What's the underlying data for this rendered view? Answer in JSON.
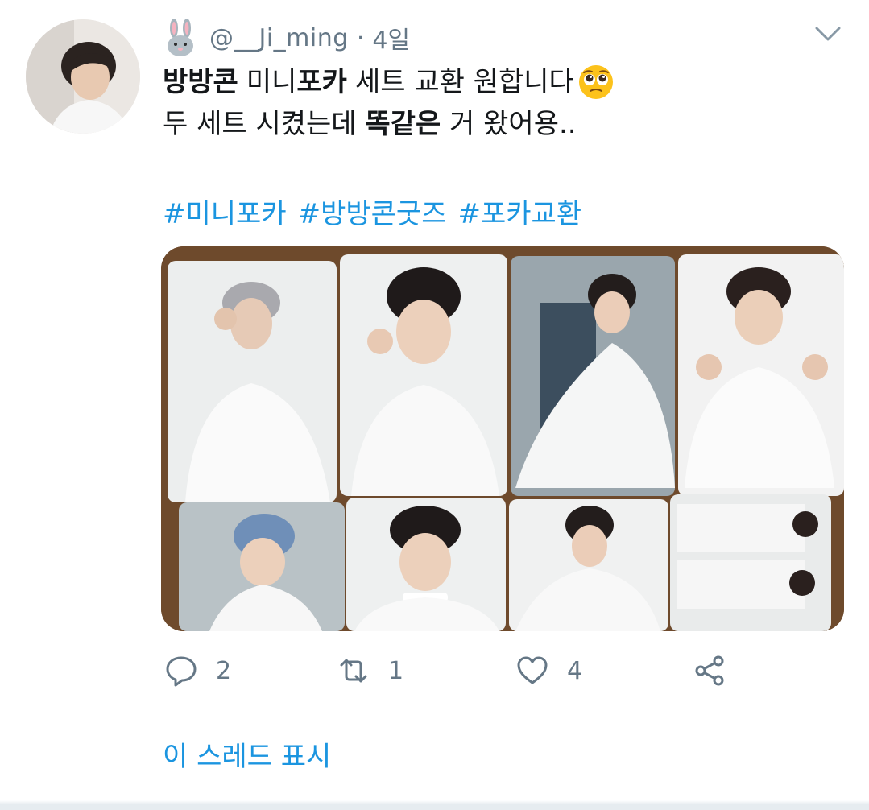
{
  "author": {
    "handle": "@__Ji_ming",
    "separator": "·",
    "time": "4일",
    "avatar_icon": "profile-photo",
    "badge_icon": "bunny-icon"
  },
  "tweet": {
    "line1_part1": "방방콘",
    "line1_part2": "미니",
    "line1_part3": "포카",
    "line1_part4": "세트 교환 원합니다",
    "line1_emoji": "pleading-face-emoji",
    "line2_part1": "두 세트 시켰는데 ",
    "line2_part2": "똑같은",
    "line2_part3": " 거 왔어용..",
    "hashtags": [
      "#미니포카",
      "#방방콘굿즈",
      "#포카교환"
    ]
  },
  "media": {
    "description_icon": "photocards-photo"
  },
  "actions": {
    "reply_count": "2",
    "retweet_count": "1",
    "like_count": "4"
  },
  "thread": {
    "label": "이 스레드 표시"
  },
  "colors": {
    "link": "#1b95e0",
    "muted": "#657786",
    "text": "#14171a"
  }
}
